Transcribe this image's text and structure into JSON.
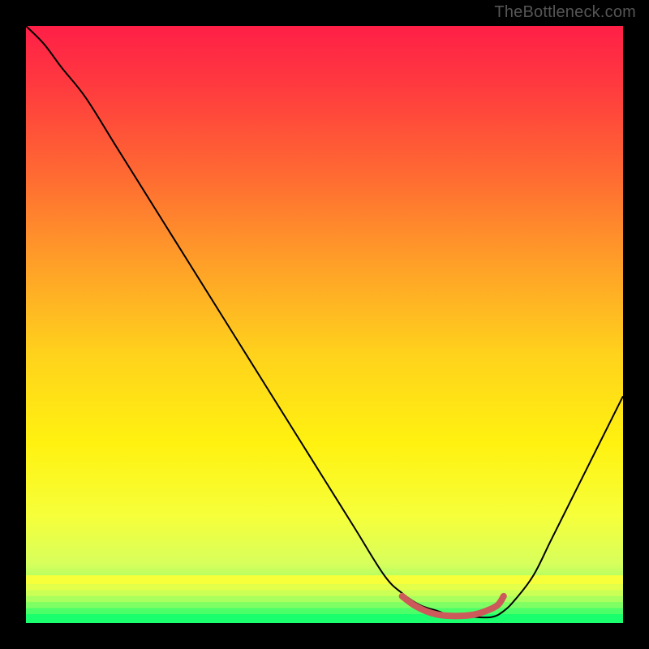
{
  "watermark": "TheBottleneck.com",
  "chart_data": {
    "type": "line",
    "title": "",
    "xlabel": "",
    "ylabel": "",
    "xlim": [
      0,
      100
    ],
    "ylim": [
      0,
      100
    ],
    "grid": false,
    "legend": false,
    "gradient_stops": [
      {
        "offset": 0.0,
        "color": "#ff1f47"
      },
      {
        "offset": 0.1,
        "color": "#ff3a3f"
      },
      {
        "offset": 0.25,
        "color": "#ff6a32"
      },
      {
        "offset": 0.4,
        "color": "#ffa028"
      },
      {
        "offset": 0.55,
        "color": "#ffd21c"
      },
      {
        "offset": 0.7,
        "color": "#fff210"
      },
      {
        "offset": 0.82,
        "color": "#f6ff3a"
      },
      {
        "offset": 0.9,
        "color": "#d8ff5c"
      },
      {
        "offset": 0.95,
        "color": "#8cff68"
      },
      {
        "offset": 1.0,
        "color": "#1aff6d"
      }
    ],
    "series": [
      {
        "name": "bottleneck-curve",
        "color": "#000000",
        "stroke_width": 2,
        "x": [
          0,
          3,
          6,
          10,
          15,
          20,
          25,
          30,
          35,
          40,
          45,
          50,
          55,
          60,
          63,
          66,
          69,
          72,
          75,
          78,
          80,
          82,
          85,
          88,
          92,
          96,
          100
        ],
        "y": [
          100,
          97,
          93,
          88,
          80,
          72,
          64,
          56,
          48,
          40,
          32,
          24,
          16,
          8,
          5,
          3,
          2,
          1,
          1,
          1,
          2,
          4,
          8,
          14,
          22,
          30,
          38
        ]
      },
      {
        "name": "optimal-range-marker",
        "color": "#cc5a5a",
        "stroke_width": 8,
        "stroke_linecap": "round",
        "x": [
          63,
          65,
          67,
          69,
          71,
          73,
          75,
          77,
          79,
          80
        ],
        "y": [
          4.5,
          3.0,
          2.0,
          1.4,
          1.2,
          1.2,
          1.4,
          2.0,
          3.0,
          4.5
        ]
      }
    ],
    "bottom_stripes": [
      {
        "y": 0.0,
        "h": 1.5,
        "color": "#1aff6d"
      },
      {
        "y": 1.5,
        "h": 1.0,
        "color": "#4cff68"
      },
      {
        "y": 2.5,
        "h": 1.0,
        "color": "#7eff63"
      },
      {
        "y": 3.5,
        "h": 1.0,
        "color": "#a8ff5d"
      },
      {
        "y": 4.5,
        "h": 1.0,
        "color": "#ccff55"
      },
      {
        "y": 5.5,
        "h": 1.0,
        "color": "#e4ff4a"
      },
      {
        "y": 6.5,
        "h": 1.5,
        "color": "#f6ff3a"
      }
    ]
  }
}
